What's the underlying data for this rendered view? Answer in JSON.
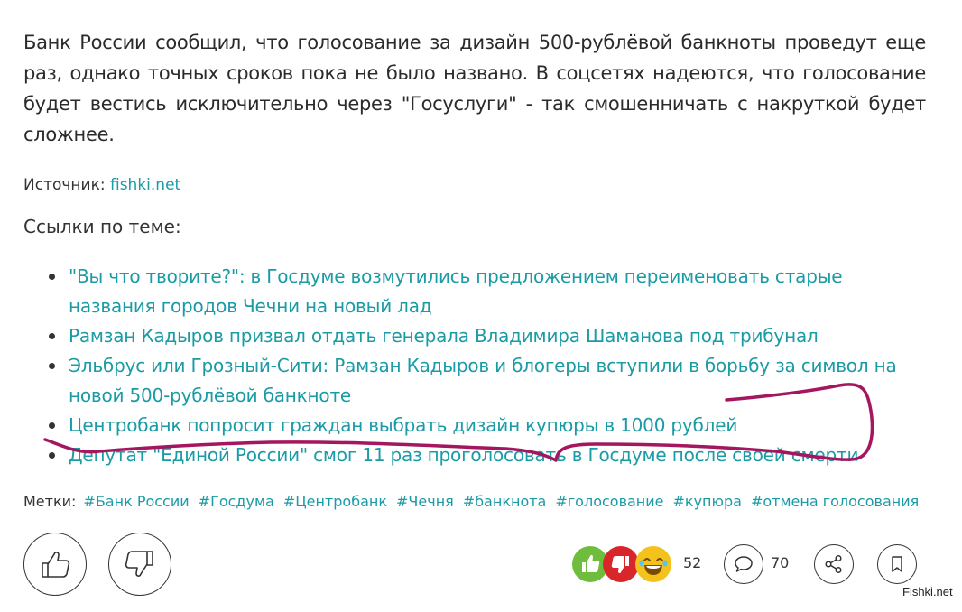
{
  "article": {
    "intro": "Банк России сообщил, что голосование за дизайн 500-рублёвой банкноты проведут еще раз, однако точных сроков пока не было названо. В соцсетях надеются, что голосование будет вестись исключительно через \"Госуслуги\" - так смошенничать с накруткой будет сложнее.",
    "source_label": "Источник: ",
    "source_link": "fishki.net",
    "links_title": "Ссылки по теме:",
    "related": [
      "\"Вы что творите?\": в Госдуме возмутились предложением переименовать старые названия городов Чечни на новый лад",
      "Рамзан Кадыров призвал отдать генерала Владимира Шаманова под трибунал",
      "Эльбрус или Грозный-Сити: Рамзан Кадыров и блогеры вступили в борьбу за символ на новой 500-рублёвой банкноте",
      "Центробанк попросит граждан выбрать дизайн купюры в 1000 рублей",
      "Депутат \"Единой России\" смог 11 раз проголосовать в Госдуме после своей смерти"
    ]
  },
  "tags": {
    "label": "Метки:",
    "items": [
      "#Банк России",
      "#Госдума",
      "#Центробанк",
      "#Чечня",
      "#банкнота",
      "#голосование",
      "#купюра",
      "#отмена голосования"
    ]
  },
  "footer": {
    "reactions_count": "52",
    "comments_count": "70",
    "watermark": "Fishki.net"
  },
  "icons": {
    "vote_up": "thumb-up-icon",
    "vote_down": "thumb-down-icon",
    "comment": "speech-bubble-icon",
    "share": "share-icon",
    "bookmark": "bookmark-icon"
  },
  "colors": {
    "link": "#1a9ba6",
    "scribble": "#a4165f",
    "reaction_like": "#6fbd3c",
    "reaction_dislike": "#d8262a",
    "reaction_laugh": "#f3c21b"
  }
}
